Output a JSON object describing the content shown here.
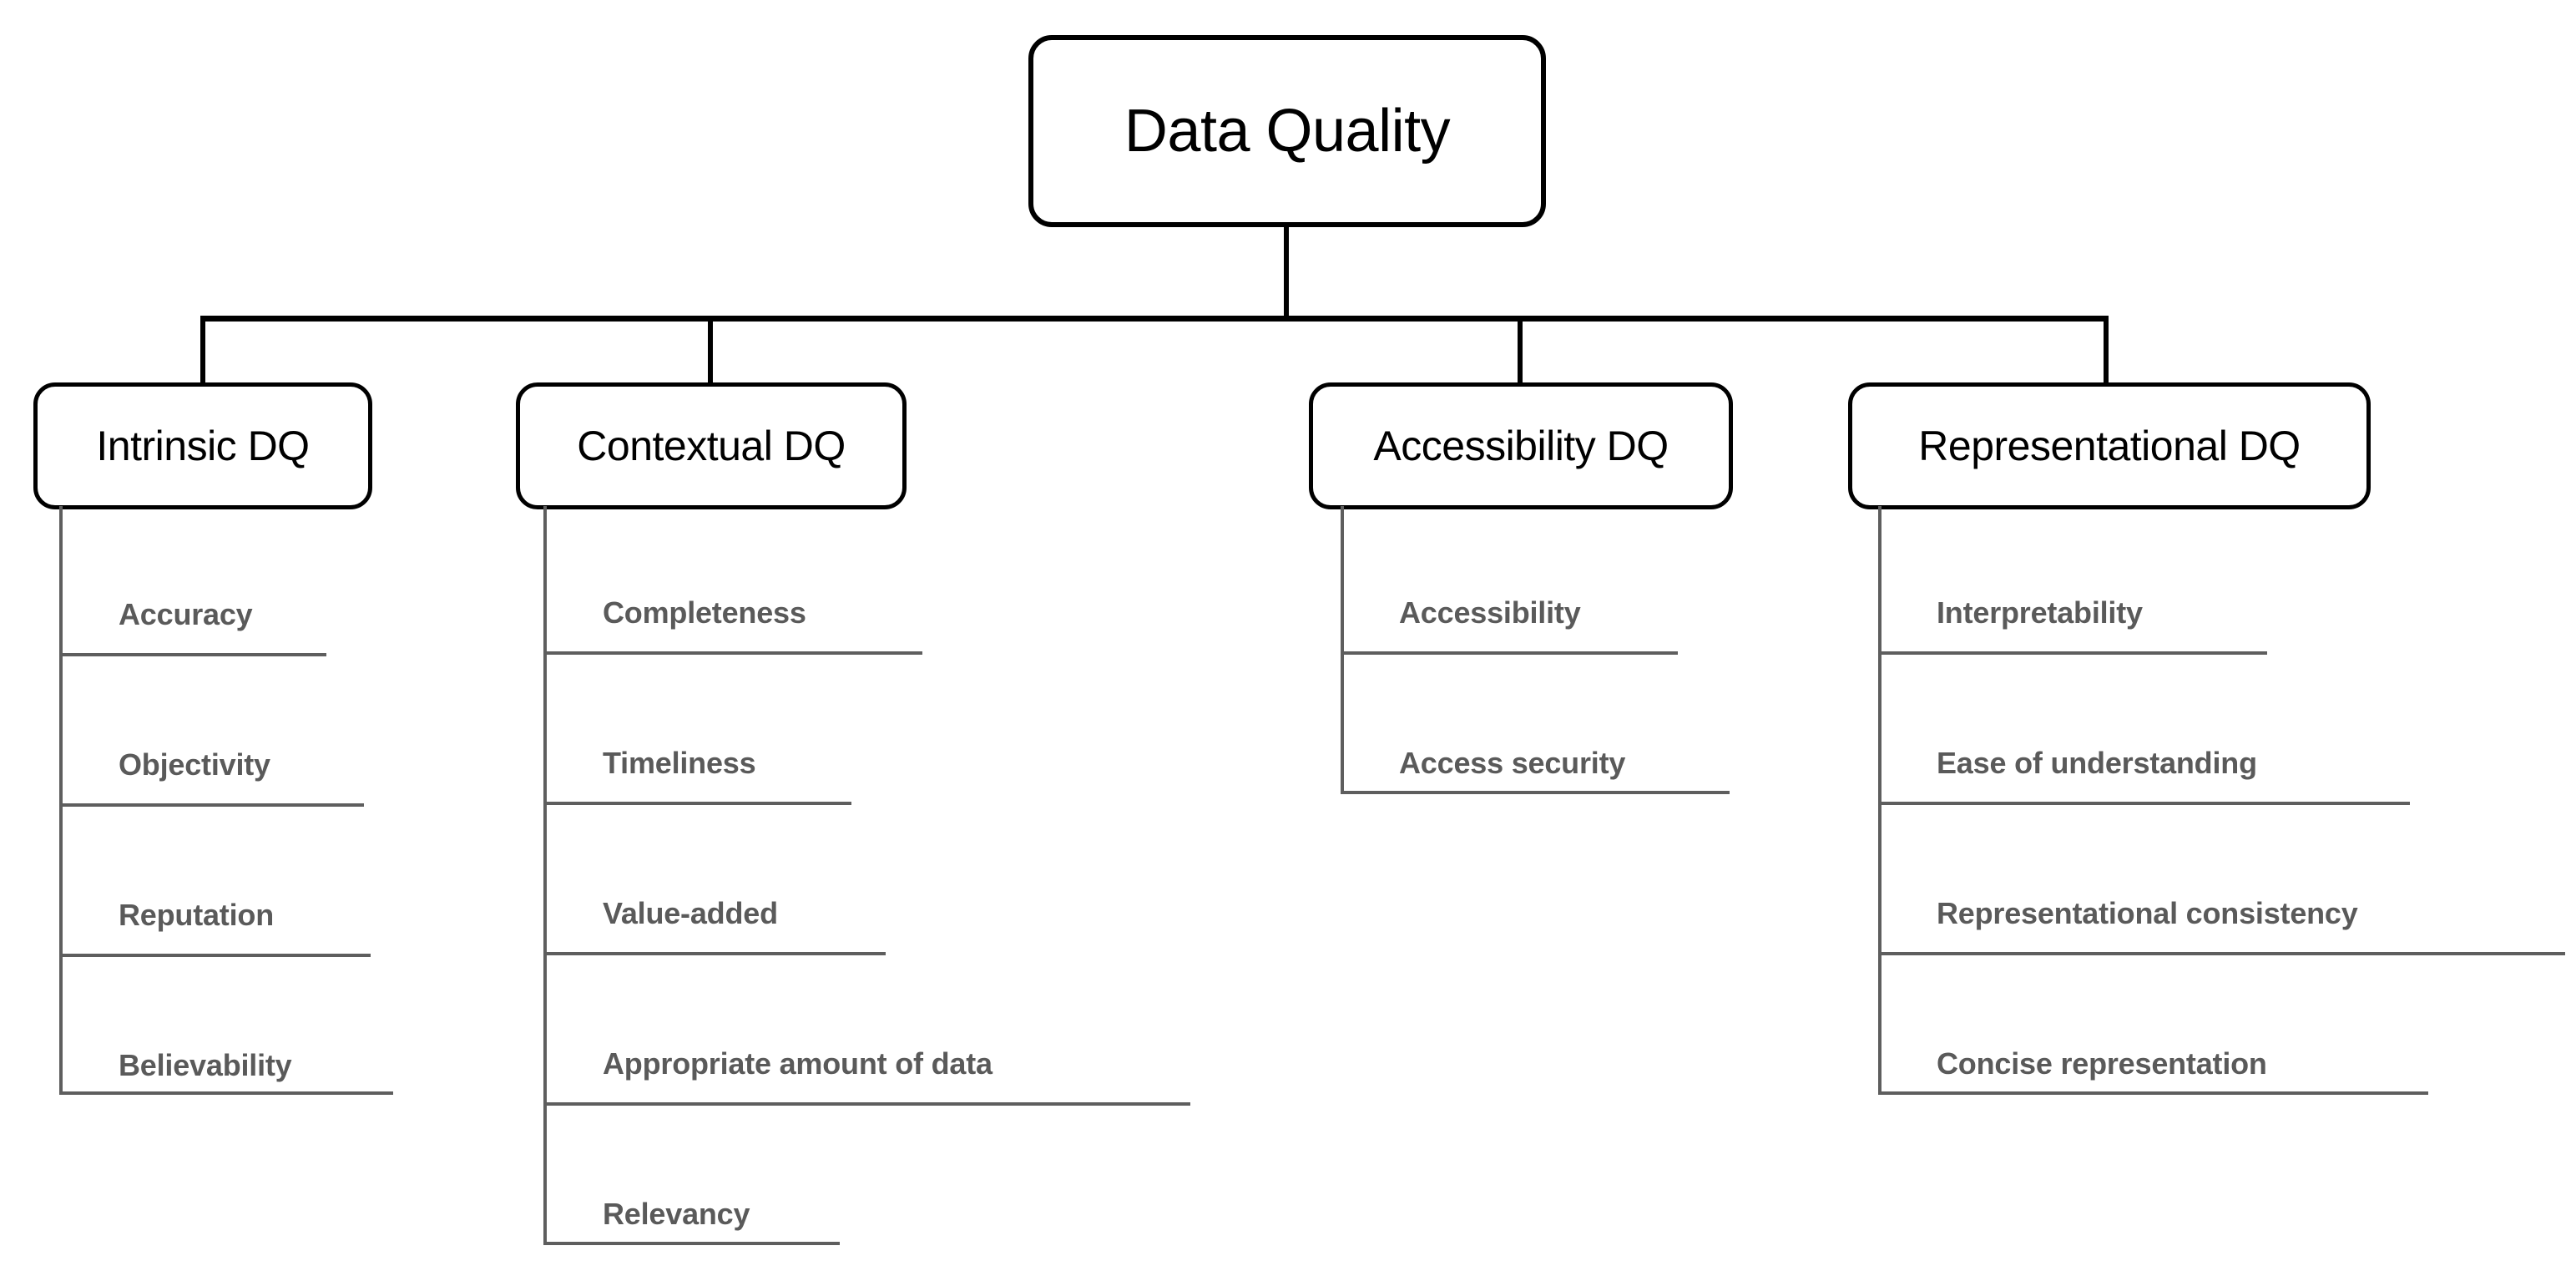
{
  "diagram": {
    "title": "Data Quality",
    "root": {
      "label": "Data Quality"
    },
    "categories": [
      {
        "label": "Intrinsic DQ",
        "items": [
          {
            "label": "Accuracy"
          },
          {
            "label": "Objectivity"
          },
          {
            "label": "Reputation"
          },
          {
            "label": "Believability"
          }
        ]
      },
      {
        "label": "Contextual DQ",
        "items": [
          {
            "label": "Completeness"
          },
          {
            "label": "Timeliness"
          },
          {
            "label": "Value-added"
          },
          {
            "label": "Appropriate amount of data"
          },
          {
            "label": "Relevancy"
          }
        ]
      },
      {
        "label": "Accessibility DQ",
        "items": [
          {
            "label": "Accessibility"
          },
          {
            "label": "Access security"
          }
        ]
      },
      {
        "label": "Representational DQ",
        "items": [
          {
            "label": "Interpretability"
          },
          {
            "label": "Ease of understanding"
          },
          {
            "label": "Representational consistency"
          },
          {
            "label": "Concise representation"
          }
        ]
      }
    ],
    "colors": {
      "node_border": "#000000",
      "node_text": "#000000",
      "leaf_text": "#5a5a5a",
      "leaf_rule": "#5e5e5e",
      "background": "#ffffff"
    }
  }
}
